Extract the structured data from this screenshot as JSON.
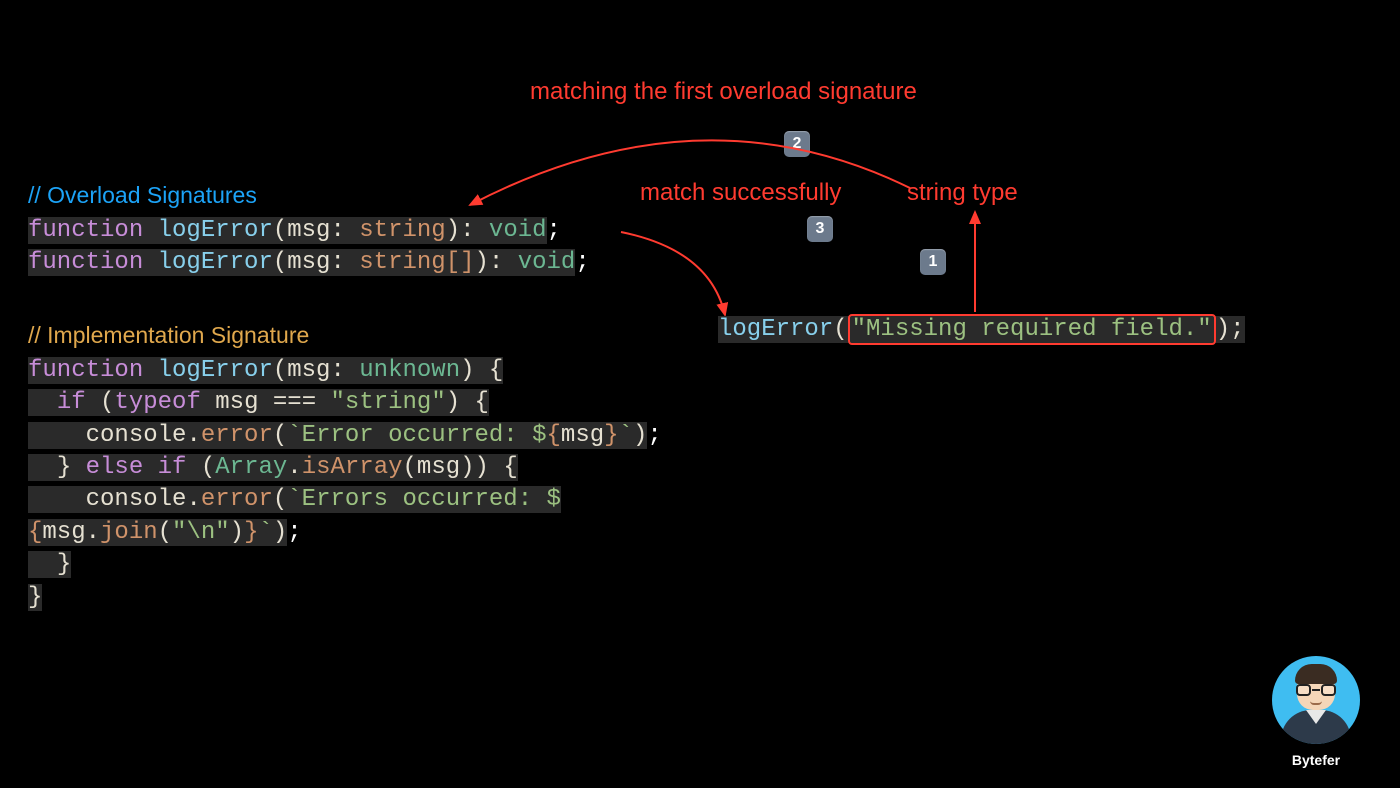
{
  "comments": {
    "overload": "// Overload Signatures",
    "impl": "// Implementation Signature"
  },
  "code": {
    "kw_function": "function",
    "fn_name": "logError",
    "param_msg": "msg",
    "type_string": "string",
    "type_string_arr": "string[]",
    "type_void": "void",
    "type_unknown": "unknown",
    "kw_if": "if",
    "kw_else": "else",
    "kw_typeof": "typeof",
    "eq": "===",
    "str_string": "\"string\"",
    "console": "console",
    "error_method": "error",
    "tmpl_err_single": "`Error occurred: $",
    "tmpl_err_multi": "`Errors occurred: $",
    "msg_ref": "msg",
    "array": "Array",
    "isArray": "isArray",
    "join": "join",
    "join_arg": "\"\\n\"",
    "brace_open": "{",
    "brace_close": "}",
    "paren_open": "(",
    "paren_close": ")",
    "semicolon": ";",
    "colon": ":",
    "dot": ".",
    "backtick_close": "`",
    "tmpl_open": "{",
    "tmpl_close": "}"
  },
  "call": {
    "fn": "logError",
    "arg": "\"Missing required field.\"",
    "paren_close_semi": ");"
  },
  "annotations": {
    "top": "matching the first overload signature",
    "match": "match successfully",
    "string_type": "string type"
  },
  "badges": {
    "one": "1",
    "two": "2",
    "three": "3"
  },
  "author": "Bytefer"
}
